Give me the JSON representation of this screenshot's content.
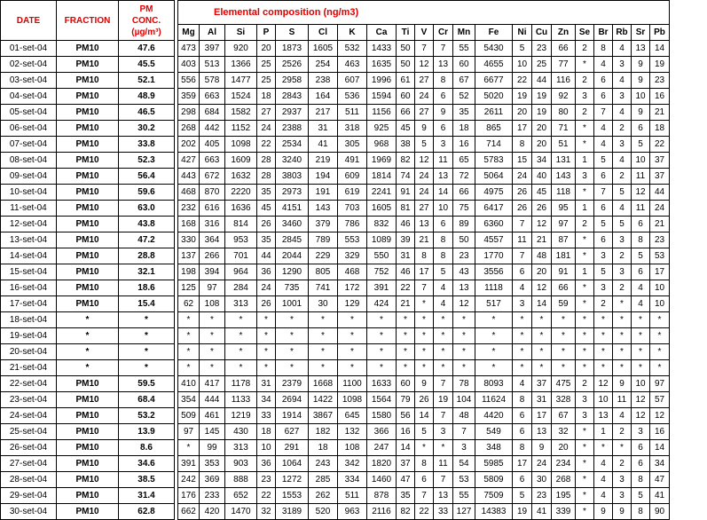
{
  "headers": {
    "date": "DATE",
    "fraction": "FRACTION",
    "pm_line1": "PM",
    "pm_line2": "CONC.",
    "pm_unit": "(µg/m³)",
    "elemental_title": "Elemental composition (ng/m3)"
  },
  "elements": [
    "Mg",
    "Al",
    "Si",
    "P",
    "S",
    "Cl",
    "K",
    "Ca",
    "Ti",
    "V",
    "Cr",
    "Mn",
    "Fe",
    "Ni",
    "Cu",
    "Zn",
    "Se",
    "Br",
    "Rb",
    "Sr",
    "Pb"
  ],
  "rows": [
    {
      "date": "01-set-04",
      "fraction": "PM10",
      "conc": "47.6",
      "vals": [
        "473",
        "397",
        "920",
        "20",
        "1873",
        "1605",
        "532",
        "1433",
        "50",
        "7",
        "7",
        "55",
        "5430",
        "5",
        "23",
        "66",
        "2",
        "8",
        "4",
        "13",
        "14"
      ]
    },
    {
      "date": "02-set-04",
      "fraction": "PM10",
      "conc": "45.5",
      "vals": [
        "403",
        "513",
        "1366",
        "25",
        "2526",
        "254",
        "463",
        "1635",
        "50",
        "12",
        "13",
        "60",
        "4655",
        "10",
        "25",
        "77",
        "*",
        "4",
        "3",
        "9",
        "19"
      ]
    },
    {
      "date": "03-set-04",
      "fraction": "PM10",
      "conc": "52.1",
      "vals": [
        "556",
        "578",
        "1477",
        "25",
        "2958",
        "238",
        "607",
        "1996",
        "61",
        "27",
        "8",
        "67",
        "6677",
        "22",
        "44",
        "116",
        "2",
        "6",
        "4",
        "9",
        "23"
      ]
    },
    {
      "date": "04-set-04",
      "fraction": "PM10",
      "conc": "48.9",
      "vals": [
        "359",
        "663",
        "1524",
        "18",
        "2843",
        "164",
        "536",
        "1594",
        "60",
        "24",
        "6",
        "52",
        "5020",
        "19",
        "19",
        "92",
        "3",
        "6",
        "3",
        "10",
        "16"
      ]
    },
    {
      "date": "05-set-04",
      "fraction": "PM10",
      "conc": "46.5",
      "vals": [
        "298",
        "684",
        "1582",
        "27",
        "2937",
        "217",
        "511",
        "1156",
        "66",
        "27",
        "9",
        "35",
        "2611",
        "20",
        "19",
        "80",
        "2",
        "7",
        "4",
        "9",
        "21"
      ]
    },
    {
      "date": "06-set-04",
      "fraction": "PM10",
      "conc": "30.2",
      "vals": [
        "268",
        "442",
        "1152",
        "24",
        "2388",
        "31",
        "318",
        "925",
        "45",
        "9",
        "6",
        "18",
        "865",
        "17",
        "20",
        "71",
        "*",
        "4",
        "2",
        "6",
        "18"
      ]
    },
    {
      "date": "07-set-04",
      "fraction": "PM10",
      "conc": "33.8",
      "vals": [
        "202",
        "405",
        "1098",
        "22",
        "2534",
        "41",
        "305",
        "968",
        "38",
        "5",
        "3",
        "16",
        "714",
        "8",
        "20",
        "51",
        "*",
        "4",
        "3",
        "5",
        "22"
      ]
    },
    {
      "date": "08-set-04",
      "fraction": "PM10",
      "conc": "52.3",
      "vals": [
        "427",
        "663",
        "1609",
        "28",
        "3240",
        "219",
        "491",
        "1969",
        "82",
        "12",
        "11",
        "65",
        "5783",
        "15",
        "34",
        "131",
        "1",
        "5",
        "4",
        "10",
        "37"
      ]
    },
    {
      "date": "09-set-04",
      "fraction": "PM10",
      "conc": "56.4",
      "vals": [
        "443",
        "672",
        "1632",
        "28",
        "3803",
        "194",
        "609",
        "1814",
        "74",
        "24",
        "13",
        "72",
        "5064",
        "24",
        "40",
        "143",
        "3",
        "6",
        "2",
        "11",
        "37"
      ]
    },
    {
      "date": "10-set-04",
      "fraction": "PM10",
      "conc": "59.6",
      "vals": [
        "468",
        "870",
        "2220",
        "35",
        "2973",
        "191",
        "619",
        "2241",
        "91",
        "24",
        "14",
        "66",
        "4975",
        "26",
        "45",
        "118",
        "*",
        "7",
        "5",
        "12",
        "44"
      ]
    },
    {
      "date": "11-set-04",
      "fraction": "PM10",
      "conc": "63.0",
      "vals": [
        "232",
        "616",
        "1636",
        "45",
        "4151",
        "143",
        "703",
        "1605",
        "81",
        "27",
        "10",
        "75",
        "6417",
        "26",
        "26",
        "95",
        "1",
        "6",
        "4",
        "11",
        "24"
      ]
    },
    {
      "date": "12-set-04",
      "fraction": "PM10",
      "conc": "43.8",
      "vals": [
        "168",
        "316",
        "814",
        "26",
        "3460",
        "379",
        "786",
        "832",
        "46",
        "13",
        "6",
        "89",
        "6360",
        "7",
        "12",
        "97",
        "2",
        "5",
        "5",
        "6",
        "21"
      ]
    },
    {
      "date": "13-set-04",
      "fraction": "PM10",
      "conc": "47.2",
      "vals": [
        "330",
        "364",
        "953",
        "35",
        "2845",
        "789",
        "553",
        "1089",
        "39",
        "21",
        "8",
        "50",
        "4557",
        "11",
        "21",
        "87",
        "*",
        "6",
        "3",
        "8",
        "23"
      ]
    },
    {
      "date": "14-set-04",
      "fraction": "PM10",
      "conc": "28.8",
      "vals": [
        "137",
        "266",
        "701",
        "44",
        "2044",
        "229",
        "329",
        "550",
        "31",
        "8",
        "8",
        "23",
        "1770",
        "7",
        "48",
        "181",
        "*",
        "3",
        "2",
        "5",
        "53"
      ]
    },
    {
      "date": "15-set-04",
      "fraction": "PM10",
      "conc": "32.1",
      "vals": [
        "198",
        "394",
        "964",
        "36",
        "1290",
        "805",
        "468",
        "752",
        "46",
        "17",
        "5",
        "43",
        "3556",
        "6",
        "20",
        "91",
        "1",
        "5",
        "3",
        "6",
        "17"
      ]
    },
    {
      "date": "16-set-04",
      "fraction": "PM10",
      "conc": "18.6",
      "vals": [
        "125",
        "97",
        "284",
        "24",
        "735",
        "741",
        "172",
        "391",
        "22",
        "7",
        "4",
        "13",
        "1118",
        "4",
        "12",
        "66",
        "*",
        "3",
        "2",
        "4",
        "10"
      ]
    },
    {
      "date": "17-set-04",
      "fraction": "PM10",
      "conc": "15.4",
      "vals": [
        "62",
        "108",
        "313",
        "26",
        "1001",
        "30",
        "129",
        "424",
        "21",
        "*",
        "4",
        "12",
        "517",
        "3",
        "14",
        "59",
        "*",
        "2",
        "*",
        "4",
        "10"
      ]
    },
    {
      "date": "18-set-04",
      "fraction": "*",
      "conc": "*",
      "vals": [
        "*",
        "*",
        "*",
        "*",
        "*",
        "*",
        "*",
        "*",
        "*",
        "*",
        "*",
        "*",
        "*",
        "*",
        "*",
        "*",
        "*",
        "*",
        "*",
        "*",
        "*"
      ]
    },
    {
      "date": "19-set-04",
      "fraction": "*",
      "conc": "*",
      "vals": [
        "*",
        "*",
        "*",
        "*",
        "*",
        "*",
        "*",
        "*",
        "*",
        "*",
        "*",
        "*",
        "*",
        "*",
        "*",
        "*",
        "*",
        "*",
        "*",
        "*",
        "*"
      ]
    },
    {
      "date": "20-set-04",
      "fraction": "*",
      "conc": "*",
      "vals": [
        "*",
        "*",
        "*",
        "*",
        "*",
        "*",
        "*",
        "*",
        "*",
        "*",
        "*",
        "*",
        "*",
        "*",
        "*",
        "*",
        "*",
        "*",
        "*",
        "*",
        "*"
      ]
    },
    {
      "date": "21-set-04",
      "fraction": "*",
      "conc": "*",
      "vals": [
        "*",
        "*",
        "*",
        "*",
        "*",
        "*",
        "*",
        "*",
        "*",
        "*",
        "*",
        "*",
        "*",
        "*",
        "*",
        "*",
        "*",
        "*",
        "*",
        "*",
        "*"
      ]
    },
    {
      "date": "22-set-04",
      "fraction": "PM10",
      "conc": "59.5",
      "vals": [
        "410",
        "417",
        "1178",
        "31",
        "2379",
        "1668",
        "1100",
        "1633",
        "60",
        "9",
        "7",
        "78",
        "8093",
        "4",
        "37",
        "475",
        "2",
        "12",
        "9",
        "10",
        "97"
      ]
    },
    {
      "date": "23-set-04",
      "fraction": "PM10",
      "conc": "68.4",
      "vals": [
        "354",
        "444",
        "1133",
        "34",
        "2694",
        "1422",
        "1098",
        "1564",
        "79",
        "26",
        "19",
        "104",
        "11624",
        "8",
        "31",
        "328",
        "3",
        "10",
        "11",
        "12",
        "57"
      ]
    },
    {
      "date": "24-set-04",
      "fraction": "PM10",
      "conc": "53.2",
      "vals": [
        "509",
        "461",
        "1219",
        "33",
        "1914",
        "3867",
        "645",
        "1580",
        "56",
        "14",
        "7",
        "48",
        "4420",
        "6",
        "17",
        "67",
        "3",
        "13",
        "4",
        "12",
        "12"
      ]
    },
    {
      "date": "25-set-04",
      "fraction": "PM10",
      "conc": "13.9",
      "vals": [
        "97",
        "145",
        "430",
        "18",
        "627",
        "182",
        "132",
        "366",
        "16",
        "5",
        "3",
        "7",
        "549",
        "6",
        "13",
        "32",
        "*",
        "1",
        "2",
        "3",
        "16"
      ]
    },
    {
      "date": "26-set-04",
      "fraction": "PM10",
      "conc": "8.6",
      "vals": [
        "*",
        "99",
        "313",
        "10",
        "291",
        "18",
        "108",
        "247",
        "14",
        "*",
        "*",
        "3",
        "348",
        "8",
        "9",
        "20",
        "*",
        "*",
        "*",
        "6",
        "14"
      ]
    },
    {
      "date": "27-set-04",
      "fraction": "PM10",
      "conc": "34.6",
      "vals": [
        "391",
        "353",
        "903",
        "36",
        "1064",
        "243",
        "342",
        "1820",
        "37",
        "8",
        "11",
        "54",
        "5985",
        "17",
        "24",
        "234",
        "*",
        "4",
        "2",
        "6",
        "34"
      ]
    },
    {
      "date": "28-set-04",
      "fraction": "PM10",
      "conc": "38.5",
      "vals": [
        "242",
        "369",
        "888",
        "23",
        "1272",
        "285",
        "334",
        "1460",
        "47",
        "6",
        "7",
        "53",
        "5809",
        "6",
        "30",
        "268",
        "*",
        "4",
        "3",
        "8",
        "47"
      ]
    },
    {
      "date": "29-set-04",
      "fraction": "PM10",
      "conc": "31.4",
      "vals": [
        "176",
        "233",
        "652",
        "22",
        "1553",
        "262",
        "511",
        "878",
        "35",
        "7",
        "13",
        "55",
        "7509",
        "5",
        "23",
        "195",
        "*",
        "4",
        "3",
        "5",
        "41"
      ]
    },
    {
      "date": "30-set-04",
      "fraction": "PM10",
      "conc": "62.8",
      "vals": [
        "662",
        "420",
        "1470",
        "32",
        "3189",
        "520",
        "963",
        "2116",
        "82",
        "22",
        "33",
        "127",
        "14383",
        "19",
        "41",
        "339",
        "*",
        "9",
        "9",
        "8",
        "90"
      ]
    }
  ]
}
